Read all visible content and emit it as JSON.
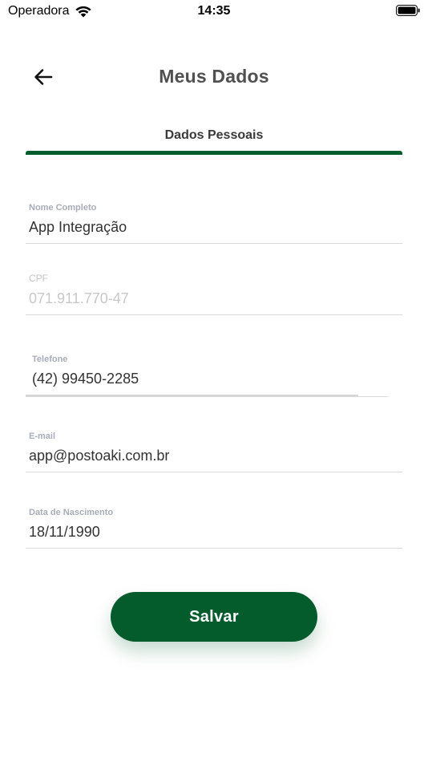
{
  "status_bar": {
    "carrier": "Operadora",
    "time": "14:35",
    "wifi_icon": "wifi-icon",
    "battery_icon": "battery-icon"
  },
  "header": {
    "back_icon": "arrow-left-icon",
    "title": "Meus Dados"
  },
  "tabs": [
    {
      "label": "Dados Pessoais",
      "active": true
    }
  ],
  "form": {
    "nome": {
      "label": "Nome Completo",
      "value": "App Integração"
    },
    "cpf": {
      "label": "CPF",
      "value": "071.911.770-47",
      "disabled": true
    },
    "telefone": {
      "label": "Telefone",
      "value": "(42) 99450-2285"
    },
    "email": {
      "label": "E-mail",
      "value": "app@postoaki.com.br"
    },
    "nascimento": {
      "label": "Data de Nascimento",
      "value": "18/11/1990"
    }
  },
  "actions": {
    "save_label": "Salvar"
  },
  "colors": {
    "primary": "#045c2c",
    "label": "#a8acb8",
    "title": "#505050"
  }
}
